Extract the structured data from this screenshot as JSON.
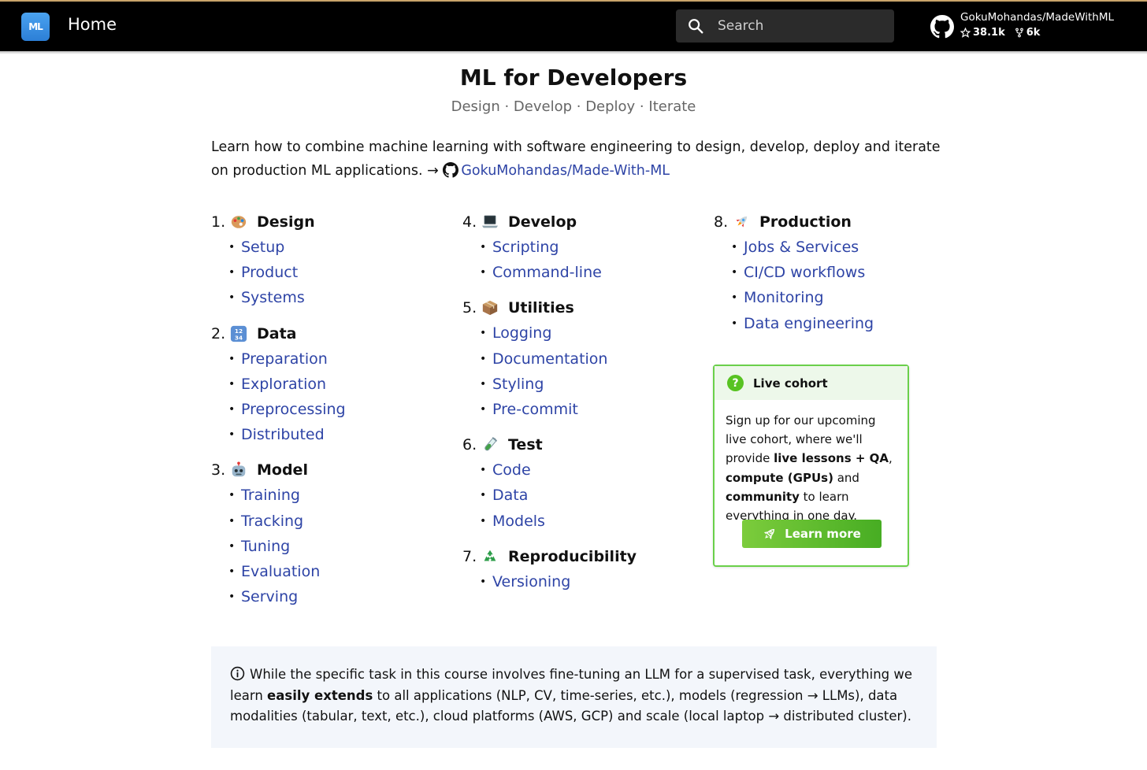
{
  "header": {
    "logo_text": "ML",
    "title": "Home",
    "search_placeholder": "Search",
    "repo": {
      "name": "GokuMohandas/MadeWithML",
      "stars": "38.1k",
      "forks": "6k"
    }
  },
  "page": {
    "title": "ML for Developers",
    "subtitle": "Design · Develop · Deploy · Iterate",
    "intro_text": "Learn how to combine machine learning with software engineering to design, develop, deploy and iterate on production ML applications. →",
    "intro_link": "GokuMohandas/Made-With-ML"
  },
  "sections": [
    {
      "num": "1.",
      "icon": "palette-icon",
      "title": "Design",
      "items": [
        "Setup",
        "Product",
        "Systems"
      ]
    },
    {
      "num": "2.",
      "icon": "numbers-icon",
      "title": "Data",
      "items": [
        "Preparation",
        "Exploration",
        "Preprocessing",
        "Distributed"
      ]
    },
    {
      "num": "3.",
      "icon": "robot-icon",
      "title": "Model",
      "items": [
        "Training",
        "Tracking",
        "Tuning",
        "Evaluation",
        "Serving"
      ]
    },
    {
      "num": "4.",
      "icon": "laptop-icon",
      "title": "Develop",
      "items": [
        "Scripting",
        "Command-line"
      ]
    },
    {
      "num": "5.",
      "icon": "package-icon",
      "title": "Utilities",
      "items": [
        "Logging",
        "Documentation",
        "Styling",
        "Pre-commit"
      ]
    },
    {
      "num": "6.",
      "icon": "test-tube-icon",
      "title": "Test",
      "items": [
        "Code",
        "Data",
        "Models"
      ]
    },
    {
      "num": "7.",
      "icon": "recycle-icon",
      "title": "Reproducibility",
      "items": [
        "Versioning"
      ]
    },
    {
      "num": "8.",
      "icon": "rocket-icon",
      "title": "Production",
      "items": [
        "Jobs & Services",
        "CI/CD workflows",
        "Monitoring",
        "Data engineering"
      ]
    }
  ],
  "cohort": {
    "title": "Live cohort",
    "body_1": "Sign up for our upcoming live cohort, where we'll provide ",
    "bold_1": "live lessons + QA",
    "body_2": ", ",
    "bold_2": "compute (GPUs)",
    "body_3": " and ",
    "bold_3": "community",
    "body_4": " to learn everything in one day.",
    "button_label": "Learn more"
  },
  "note": {
    "text_1": "While the specific task in this course involves fine-tuning an LLM for a supervised task, everything we learn ",
    "bold": "easily extends",
    "text_2": " to all applications (NLP, CV, time-series, etc.), models (regression → LLMs), data modalities (tabular, text, etc.), cloud platforms (AWS, GCP) and scale (local laptop → distributed cluster)."
  },
  "colors": {
    "link": "#2e44a6",
    "header_bg": "#000000",
    "cohort_border": "#6ad04a",
    "button_green": "#47ad23"
  }
}
